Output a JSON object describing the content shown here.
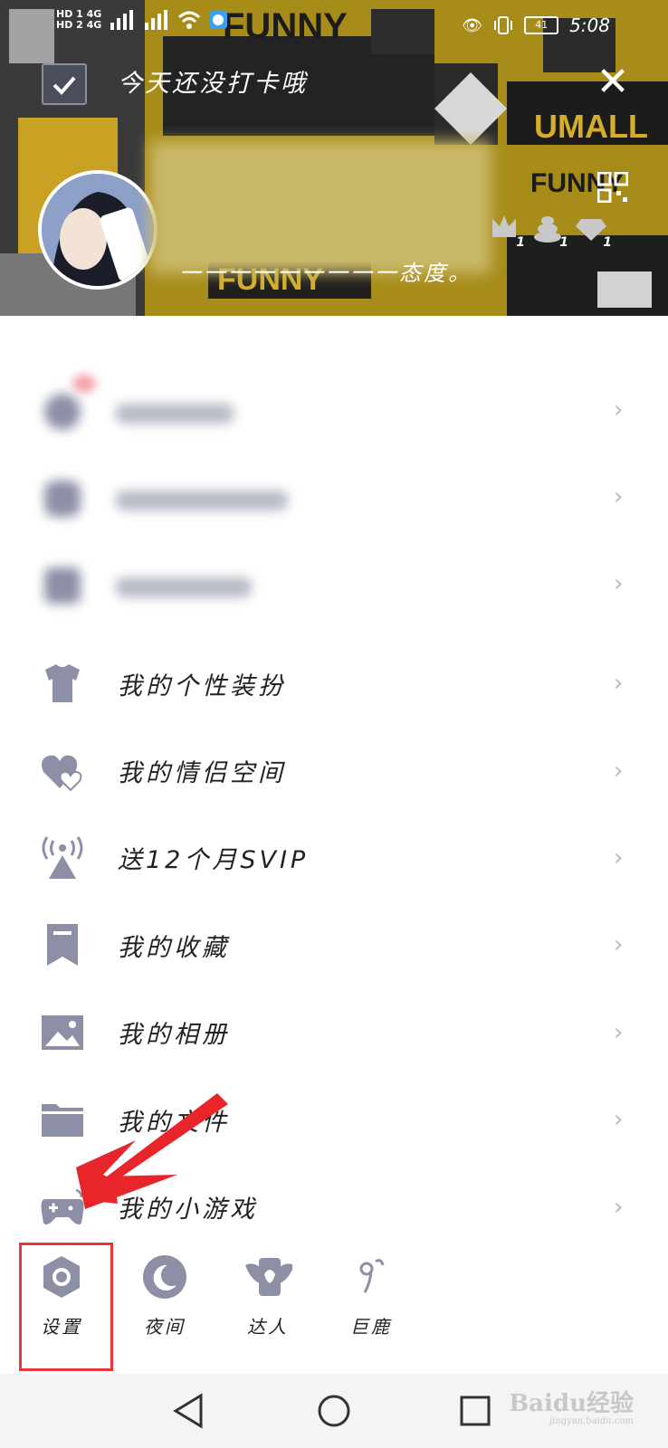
{
  "status_bar": {
    "time": "5:08",
    "battery": "41",
    "network_1": "HD 1 4G",
    "network_2": "HD 2 4G"
  },
  "header": {
    "checkin_text": "今天还没打卡哦",
    "signature": "一一一一一一一一一态度。",
    "pattern_words": [
      "FUNNY",
      "UMALL",
      "FUNNY",
      "FUNNY"
    ],
    "medal_counts": [
      "1",
      "1",
      "1"
    ]
  },
  "menu": {
    "items": [
      {
        "label": "我的个性装扮",
        "icon": "tshirt-icon"
      },
      {
        "label": "我的情侣空间",
        "icon": "hearts-icon"
      },
      {
        "label": "送12个月SVIP",
        "icon": "broadcast-icon"
      },
      {
        "label": "我的收藏",
        "icon": "bookmark-icon"
      },
      {
        "label": "我的相册",
        "icon": "image-icon"
      },
      {
        "label": "我的文件",
        "icon": "folder-icon"
      },
      {
        "label": "我的小游戏",
        "icon": "gamepad-icon"
      }
    ],
    "chevron": "›"
  },
  "quick_actions": [
    {
      "label": "设置",
      "icon": "settings-hex-icon"
    },
    {
      "label": "夜间",
      "icon": "moon-icon"
    },
    {
      "label": "达人",
      "icon": "winged-badge-icon"
    },
    {
      "label": "巨鹿",
      "icon": "deer-icon"
    }
  ],
  "watermark": {
    "brand": "Baidu经验",
    "url": "jingyan.baidu.com"
  },
  "colors": {
    "header_bg": "#a88c1a",
    "icon_gray": "#8c8fa6",
    "highlight_red": "#e8353a"
  }
}
